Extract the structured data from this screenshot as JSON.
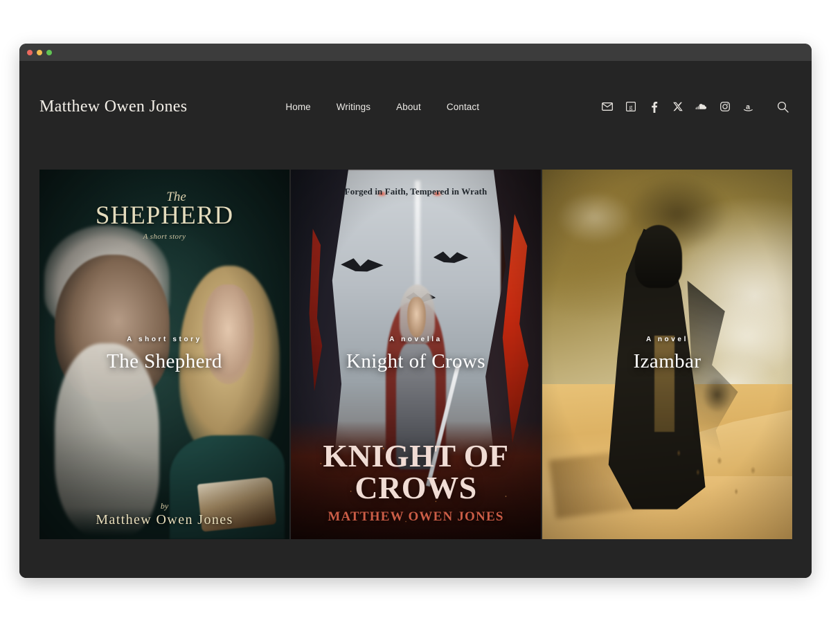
{
  "window": {
    "traffic_lights": [
      "close",
      "minimize",
      "maximize"
    ]
  },
  "header": {
    "brand": "Matthew Owen Jones",
    "nav": [
      {
        "label": "Home"
      },
      {
        "label": "Writings"
      },
      {
        "label": "About"
      },
      {
        "label": "Contact"
      }
    ],
    "social": [
      {
        "name": "email-icon"
      },
      {
        "name": "goodreads-icon"
      },
      {
        "name": "facebook-icon"
      },
      {
        "name": "x-twitter-icon"
      },
      {
        "name": "soundcloud-icon"
      },
      {
        "name": "instagram-icon"
      },
      {
        "name": "amazon-icon"
      }
    ],
    "search_icon": "search-icon"
  },
  "covers": [
    {
      "id": "the-shepherd",
      "kicker": "A short story",
      "title": "The Shepherd",
      "art_text": {
        "the": "The",
        "main": "SHEPHERD",
        "subtitle": "A short story",
        "by": "by",
        "author": "Matthew Owen Jones"
      }
    },
    {
      "id": "knight-of-crows",
      "kicker": "A novella",
      "title": "Knight of Crows",
      "art_text": {
        "tagline": "Forged in Faith, Tempered in Wrath",
        "title": "KNIGHT OF CROWS",
        "author": "MATTHEW OWEN JONES"
      }
    },
    {
      "id": "izambar",
      "kicker": "A novel",
      "title": "Izambar",
      "art_text": {}
    }
  ],
  "colors": {
    "page_background": "#ffffff",
    "window_titlebar": "#3c3c3c",
    "site_background": "#252525",
    "text_primary": "#f3efe8",
    "cover1_gold": "#e4dcbd",
    "cover2_accent": "#cc5d46",
    "cover3_sand": "#e8c277"
  }
}
